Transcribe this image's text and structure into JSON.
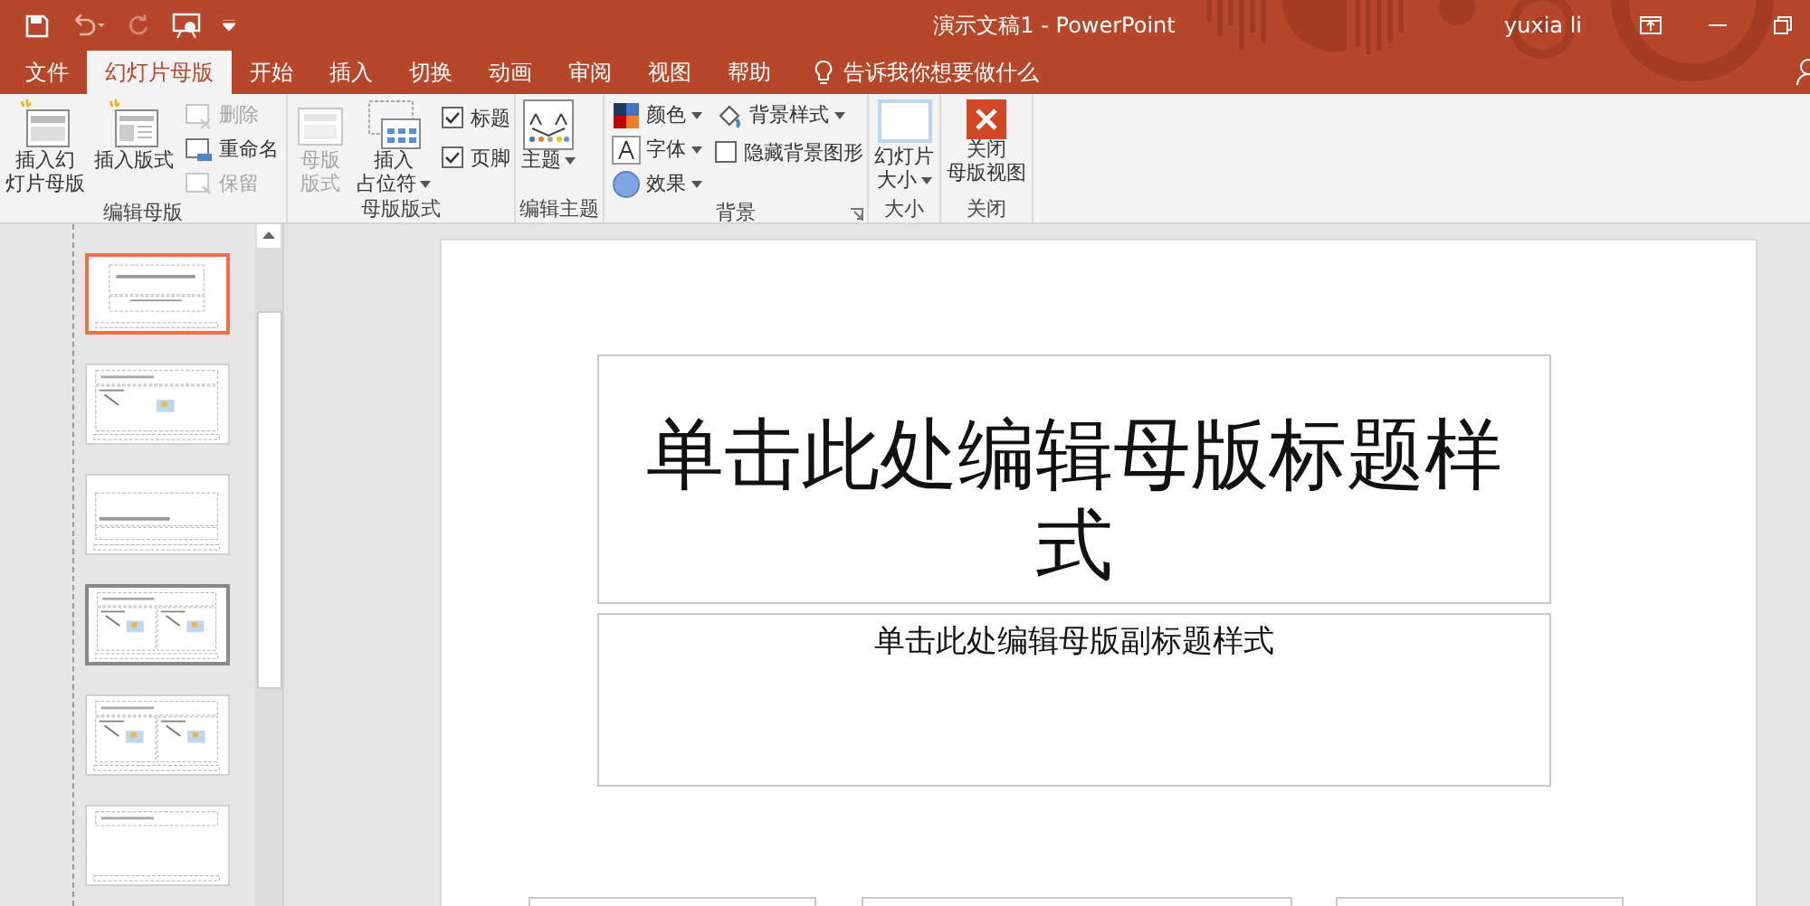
{
  "window": {
    "title": "演示文稿1  -  PowerPoint",
    "user": "yuxia li"
  },
  "tabs": [
    {
      "label": "文件",
      "selected": false
    },
    {
      "label": "幻灯片母版",
      "selected": true
    },
    {
      "label": "开始",
      "selected": false
    },
    {
      "label": "插入",
      "selected": false
    },
    {
      "label": "切换",
      "selected": false
    },
    {
      "label": "动画",
      "selected": false
    },
    {
      "label": "审阅",
      "selected": false
    },
    {
      "label": "视图",
      "selected": false
    },
    {
      "label": "帮助",
      "selected": false
    }
  ],
  "tell_me": {
    "label": "告诉我你想要做什么"
  },
  "ribbon": {
    "edit_master": {
      "label": "编辑母版",
      "insert_slide_master": {
        "label": [
          "插入幻",
          "灯片母版"
        ]
      },
      "insert_layout": {
        "label": [
          "插入版式"
        ]
      },
      "delete": {
        "label": "删除",
        "disabled": true
      },
      "rename": {
        "label": "重命名",
        "disabled": false
      },
      "preserve": {
        "label": "保留",
        "disabled": true
      }
    },
    "master_layout": {
      "label": "母版版式",
      "master_layout_button": {
        "label": [
          "母版",
          "版式"
        ],
        "disabled": true
      },
      "insert_placeholder": {
        "label": [
          "插入",
          "占位符"
        ]
      },
      "title_check": {
        "label": "标题",
        "checked": true
      },
      "footer_check": {
        "label": "页脚",
        "checked": true
      }
    },
    "edit_theme": {
      "label": "编辑主题",
      "themes": {
        "label": [
          "主题"
        ]
      }
    },
    "background": {
      "label": "背景",
      "colors": {
        "label": "颜色"
      },
      "fonts": {
        "label": "字体"
      },
      "effects": {
        "label": "效果"
      },
      "background_styles": {
        "label": "背景样式"
      },
      "hide_background_graphics": {
        "label": "隐藏背景图形",
        "checked": false
      }
    },
    "size": {
      "label": "大小",
      "slide_size": {
        "label": [
          "幻灯片",
          "大小"
        ]
      }
    },
    "close": {
      "label": "关闭",
      "close_master_view": {
        "label": [
          "关闭",
          "母版视图"
        ]
      }
    }
  },
  "thumbnails": [
    {
      "kind": "title",
      "selected": true,
      "hovered": false
    },
    {
      "kind": "content",
      "selected": false,
      "hovered": false
    },
    {
      "kind": "section",
      "selected": false,
      "hovered": false
    },
    {
      "kind": "two",
      "selected": false,
      "hovered": true
    },
    {
      "kind": "comparison",
      "selected": false,
      "hovered": false
    },
    {
      "kind": "title_only",
      "selected": false,
      "hovered": false
    }
  ],
  "slide": {
    "title_placeholder": "单击此处编辑母版标题样式",
    "subtitle_placeholder": "单击此处编辑母版副标题样式"
  }
}
